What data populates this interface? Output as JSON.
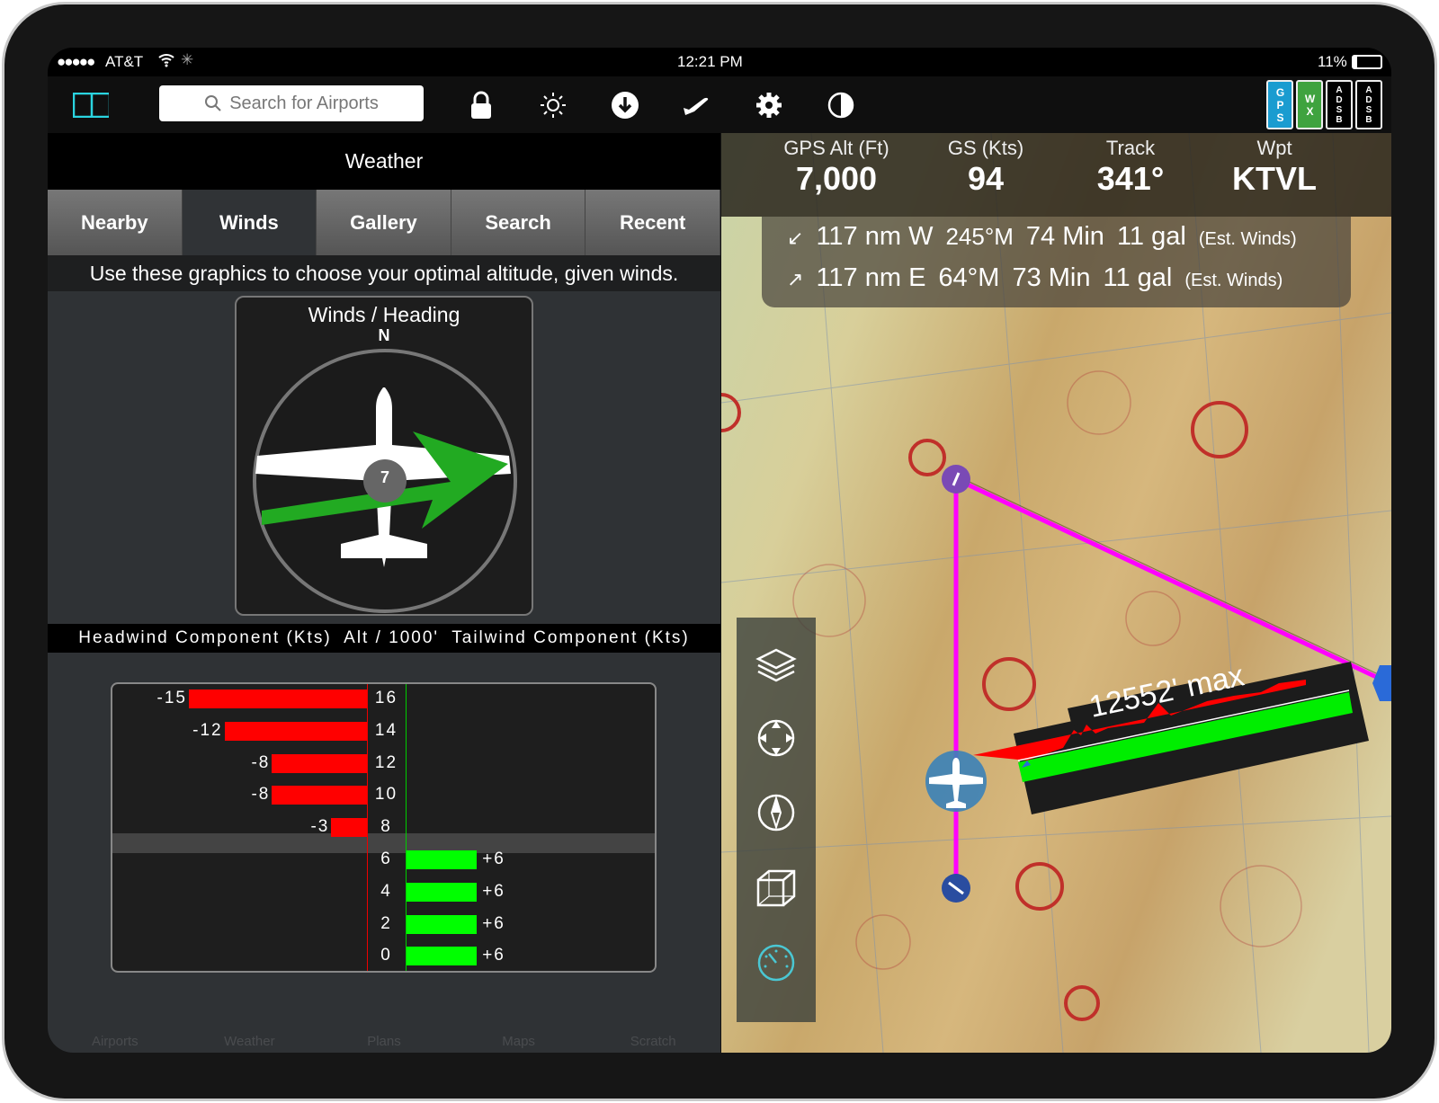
{
  "status_bar": {
    "carrier": "AT&T",
    "signal_dots": "●●●●●",
    "time": "12:21 PM",
    "battery": "11%"
  },
  "toolbar": {
    "search_placeholder": "Search for Airports",
    "icons": [
      "split-view-icon",
      "lock-icon",
      "brightness-icon",
      "download-icon",
      "airplane-icon",
      "gear-icon",
      "contrast-icon"
    ],
    "badges": [
      {
        "label": "GPS",
        "color": "#1a9cd0"
      },
      {
        "label": "WX",
        "color": "#3fa33f"
      },
      {
        "label": "ADSB",
        "color": "#000000"
      },
      {
        "label": "ADSB",
        "color": "#000000"
      }
    ]
  },
  "weather": {
    "title": "Weather",
    "tabs": [
      "Nearby",
      "Winds",
      "Gallery",
      "Search",
      "Recent"
    ],
    "active_tab": "Winds",
    "instruction": "Use these graphics to choose your optimal altitude, given winds.",
    "compass": {
      "title": "Winds / Heading",
      "north": "N",
      "wind_speed": "7"
    },
    "component_header": "Headwind Component (Kts)  Alt / 1000'  Tailwind Component (Kts)"
  },
  "chart_data": {
    "type": "bar",
    "title": "",
    "xlabel": "Headwind Component (Kts) / Tailwind Component (Kts)",
    "ylabel": "Alt / 1000'",
    "categories": [
      "16",
      "14",
      "12",
      "10",
      "8",
      "6",
      "4",
      "2",
      "0"
    ],
    "rows": [
      {
        "alt": "16",
        "value": -15,
        "label": "-15"
      },
      {
        "alt": "14",
        "value": -12,
        "label": "-12"
      },
      {
        "alt": "12",
        "value": -8,
        "label": "-8"
      },
      {
        "alt": "10",
        "value": -8,
        "label": "-8"
      },
      {
        "alt": "8",
        "value": -3,
        "label": "-3"
      },
      {
        "alt": "6",
        "value": 6,
        "label": "+6"
      },
      {
        "alt": "4",
        "value": 6,
        "label": "+6"
      },
      {
        "alt": "2",
        "value": 6,
        "label": "+6"
      },
      {
        "alt": "0",
        "value": 6,
        "label": "+6"
      }
    ],
    "current_altitude": "7",
    "headwind_color": "#ff0000",
    "tailwind_color": "#00ff00",
    "xlim": [
      -15,
      20
    ]
  },
  "bottom_tabs": [
    "Airports",
    "Weather",
    "Plans",
    "Maps",
    "Scratch"
  ],
  "map": {
    "data_bar": [
      {
        "label": "GPS Alt (Ft)",
        "value": "7,000"
      },
      {
        "label": "GS (Kts)",
        "value": "94"
      },
      {
        "label": "Track",
        "value": "341°"
      },
      {
        "label": "Wpt",
        "value": "KTVL"
      }
    ],
    "legs": [
      {
        "arrow": "↙",
        "dist": "117 nm W",
        "course": "245°M",
        "time": "74 Min",
        "fuel": "11 gal",
        "note": "(Est. Winds)"
      },
      {
        "arrow": "↗",
        "dist": "117 nm E",
        "course": "64°M",
        "time": "73 Min",
        "fuel": "11 gal",
        "note": "(Est. Winds)"
      }
    ],
    "profile_label": "12552' max",
    "route_color": "#ff00ff",
    "sidebar_icons": [
      "layers-icon",
      "center-icon",
      "north-up-icon",
      "3d-view-icon",
      "gauge-icon"
    ]
  }
}
